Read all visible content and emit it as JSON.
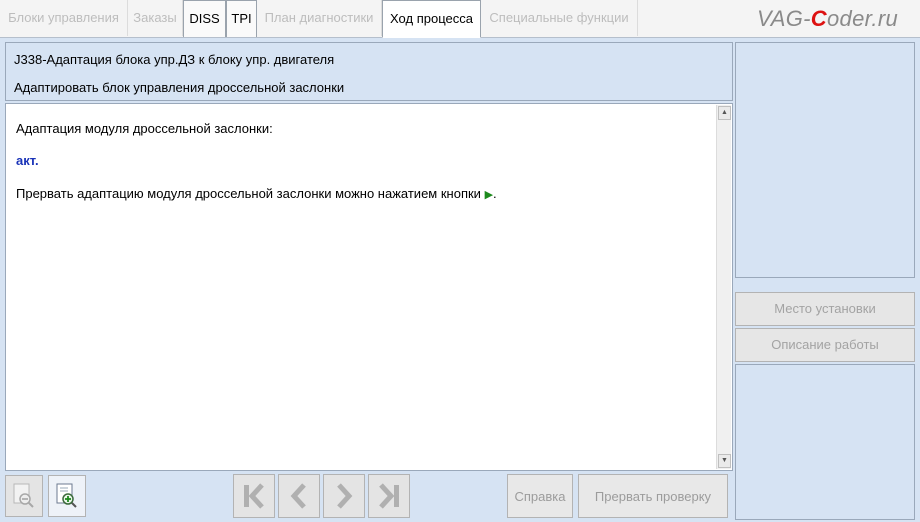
{
  "tabs": [
    {
      "label": "Блоки управления",
      "state": "disabled"
    },
    {
      "label": "Заказы",
      "state": "disabled"
    },
    {
      "label": "DISS",
      "state": "enabled"
    },
    {
      "label": "TPI",
      "state": "enabled"
    },
    {
      "label": "План диагностики",
      "state": "disabled"
    },
    {
      "label": "Ход процесса",
      "state": "selected"
    },
    {
      "label": "Специальные функции",
      "state": "disabled"
    }
  ],
  "brand": {
    "pre": "VAG-",
    "accent": "C",
    "post": "oder.ru",
    "accent_color": "#dd1111"
  },
  "header": {
    "line1": "J338-Адаптация блока упр.ДЗ к блоку упр. двигателя",
    "line2": "Адаптировать блок управления дроссельной заслонки"
  },
  "content": {
    "line1": "Адаптация модуля дроссельной заслонки:",
    "status": "акт.",
    "line3": "Прервать адаптацию модуля дроссельной заслонки можно нажатием кнопки",
    "line3_icon": "green-play-icon",
    "line3_end": "."
  },
  "toolbar": {
    "zoom_out_icon": "zoom-out-icon",
    "zoom_in_icon": "zoom-in-icon",
    "nav_first": "first-page-icon",
    "nav_prev": "previous-page-icon",
    "nav_next": "next-page-icon",
    "nav_last": "last-page-icon",
    "help_label": "Справка",
    "abort_label": "Прервать проверку"
  },
  "side": {
    "location_label": "Место установки",
    "work_desc_label": "Описание работы"
  },
  "colors": {
    "panel_bg": "#d6e3f3",
    "status_text": "#1a33b8",
    "play_icon": "#1d8a1d"
  }
}
